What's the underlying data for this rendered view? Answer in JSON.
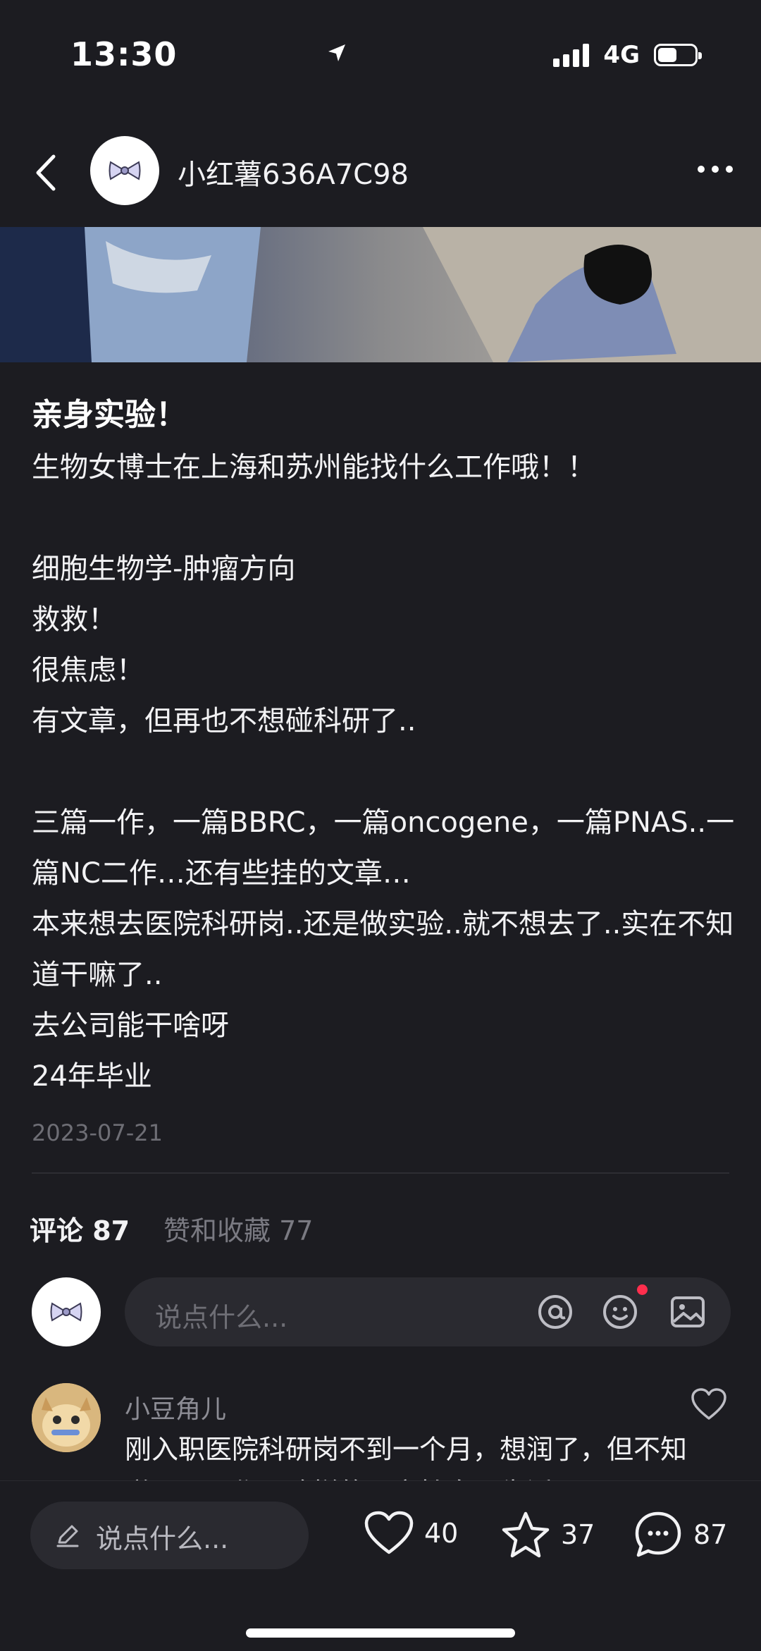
{
  "status_bar": {
    "time": "13:30",
    "network": "4G",
    "battery_level": 0.5
  },
  "header": {
    "author": "小红薯636A7C98",
    "avatar_icon": "bow-icon"
  },
  "post": {
    "title": "亲身实验！",
    "body": "生物女博士在上海和苏州能找什么工作哦！！\n\n细胞生物学-肿瘤方向\n救救！\n很焦虑！\n有文章，但再也不想碰科研了..\n\n三篇一作，一篇BBRC，一篇oncogene，一篇PNAS..一篇NC二作…还有些挂的文章…\n本来想去医院科研岗..还是做实验..就不想去了..实在不知道干嘛了..\n去公司能干啥呀\n24年毕业",
    "date": "2023-07-21"
  },
  "tabs": {
    "comments": "评论 87",
    "likes": "赞和收藏 77"
  },
  "comment_input": {
    "placeholder": "说点什么..."
  },
  "first_comment": {
    "name": "小豆角儿",
    "text": "刚入职医院科研岗不到一个月，想润了，但不知道公司工作是啥样的，害怕自己生活And"
  },
  "bottom_bar": {
    "placeholder": "说点什么...",
    "likes": "40",
    "collects": "37",
    "comments": "87"
  },
  "colors": {
    "background": "#1c1c21",
    "accent_dot": "#ff2e4d"
  }
}
